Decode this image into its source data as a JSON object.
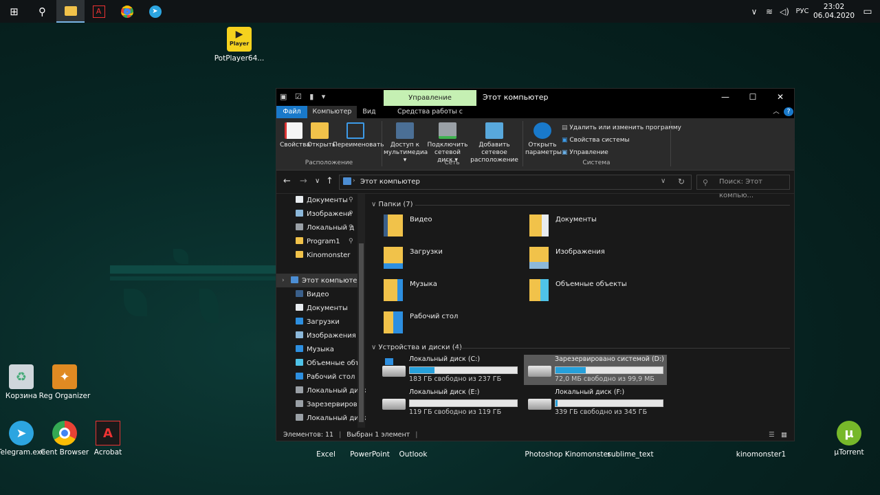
{
  "taskbar": {
    "lang": "РУС",
    "time": "23:02",
    "date": "06.04.2020"
  },
  "desktop": {
    "icons": [
      {
        "label": "PotPlayer64..."
      },
      {
        "label": "Корзина"
      },
      {
        "label": "Reg Organizer"
      },
      {
        "label": "Telegram.exe"
      },
      {
        "label": "Cent Browser"
      },
      {
        "label": "Acrobat"
      },
      {
        "label": "Excel"
      },
      {
        "label": "PowerPoint"
      },
      {
        "label": "Outlook"
      },
      {
        "label": "Photoshop"
      },
      {
        "label": "Kinomonster"
      },
      {
        "label": "sublime_text"
      },
      {
        "label": "kinomonster1"
      },
      {
        "label": "µTorrent"
      }
    ],
    "potplayer_badge": "Player"
  },
  "window": {
    "title": "Этот компьютер",
    "context_tab": "Управление",
    "tabs": [
      "Файл",
      "Компьютер",
      "Вид",
      "Средства работы с дисками"
    ],
    "ribbon": {
      "buttons": [
        {
          "label": "Свойства"
        },
        {
          "label": "Открыть"
        },
        {
          "label": "Переименовать"
        },
        {
          "label": "Доступ к мультимедиа ▾"
        },
        {
          "label": "Подключить сетевой диск ▾"
        },
        {
          "label": "Добавить сетевое расположение"
        },
        {
          "label": "Открыть параметры"
        }
      ],
      "small": [
        "Удалить или изменить программу",
        "Свойства системы",
        "Управление"
      ],
      "groups": [
        "Расположение",
        "Сеть",
        "Система"
      ]
    },
    "address": "Этот компьютер",
    "search_placeholder": "Поиск: Этот компью...",
    "nav": [
      {
        "label": "Документы",
        "pin": true
      },
      {
        "label": "Изображени",
        "pin": true
      },
      {
        "label": "Локальный д",
        "pin": true
      },
      {
        "label": "Program1",
        "pin": true
      },
      {
        "label": "Kinomonster",
        "pin": false
      },
      {
        "label": "Этот компьютер",
        "pin": false
      },
      {
        "label": "Видео",
        "pin": false
      },
      {
        "label": "Документы",
        "pin": false
      },
      {
        "label": "Загрузки",
        "pin": false
      },
      {
        "label": "Изображения",
        "pin": false
      },
      {
        "label": "Музыка",
        "pin": false
      },
      {
        "label": "Объемные объ",
        "pin": false
      },
      {
        "label": "Рабочий стол",
        "pin": false
      },
      {
        "label": "Локальный диск",
        "pin": false
      },
      {
        "label": "Зарезервирова",
        "pin": false
      },
      {
        "label": "Локальный диск",
        "pin": false
      },
      {
        "label": "Локальный диск",
        "pin": false
      }
    ],
    "folders_header": "Папки (7)",
    "folders": [
      {
        "label": "Видео"
      },
      {
        "label": "Документы"
      },
      {
        "label": "Загрузки"
      },
      {
        "label": "Изображения"
      },
      {
        "label": "Музыка"
      },
      {
        "label": "Объемные объекты"
      },
      {
        "label": "Рабочий стол"
      }
    ],
    "drives_header": "Устройства и диски (4)",
    "drives": [
      {
        "name": "Локальный диск (C:)",
        "free": "183 ГБ свободно из 237 ГБ",
        "used_fraction": 0.23
      },
      {
        "name": "Зарезервировано системой (D:)",
        "free": "72,0 МБ свободно из 99,9 МБ",
        "used_fraction": 0.28
      },
      {
        "name": "Локальный диск (E:)",
        "free": "119 ГБ свободно из 119 ГБ",
        "used_fraction": 0.0
      },
      {
        "name": "Локальный диск (F:)",
        "free": "339 ГБ свободно из 345 ГБ",
        "used_fraction": 0.02
      }
    ],
    "status": {
      "items": "Элементов: 11",
      "selected": "Выбран 1 элемент"
    }
  }
}
